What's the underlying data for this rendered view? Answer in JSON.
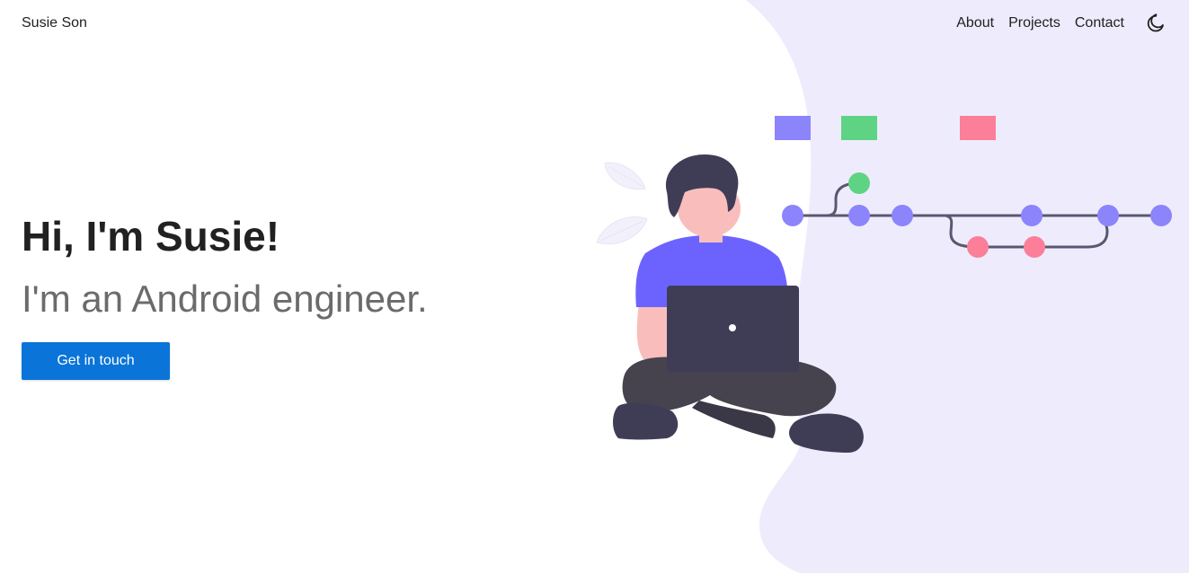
{
  "brand": {
    "name": "Susie Son"
  },
  "nav": {
    "items": [
      {
        "label": "About"
      },
      {
        "label": "Projects"
      },
      {
        "label": "Contact"
      }
    ],
    "theme_toggle_icon": "moon-icon"
  },
  "hero": {
    "greeting": "Hi, I'm Susie!",
    "subtitle": "I'm an Android engineer.",
    "cta_label": "Get in touch"
  },
  "colors": {
    "accent": "#0a74d8",
    "background_blob": "#eeecfc",
    "branch_purple": "#8b84fb",
    "branch_green": "#5fd384",
    "branch_pink": "#fb7f99",
    "line": "#5a5870"
  },
  "illustration": {
    "subject": "person-with-laptop-git-graph"
  }
}
